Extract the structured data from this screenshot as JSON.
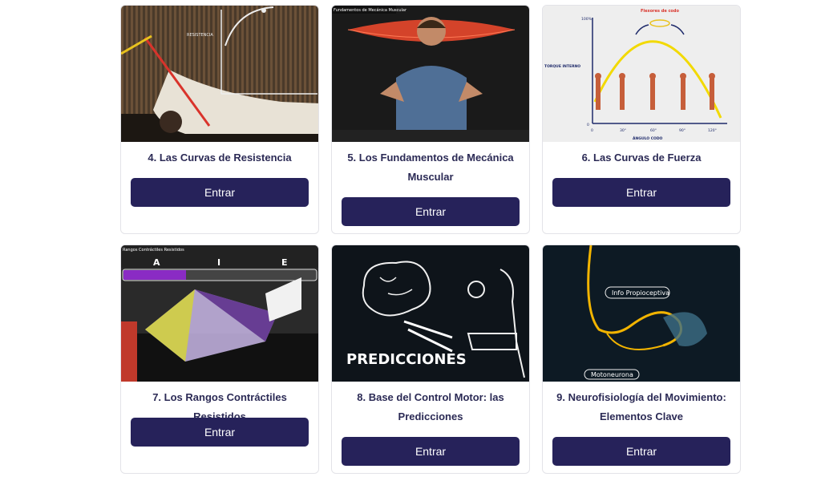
{
  "cards": [
    {
      "title": "4. Las Curvas de Resistencia",
      "button": "Entrar",
      "thumb_labels": [
        "RESISTENCIA"
      ]
    },
    {
      "title": "5. Los Fundamentos de Mecánica Muscular",
      "button": "Entrar",
      "thumb_labels": [
        "Fundamentos de Mecánica Muscular"
      ]
    },
    {
      "title": "6. Las Curvas de Fuerza",
      "button": "Entrar",
      "thumb_labels": [
        "Flexores de codo",
        "TORQUE INTERNO",
        "ÁNGULO CODO",
        "100%",
        "0",
        "30°",
        "60°",
        "90°",
        "120°"
      ]
    },
    {
      "title": "7. Los Rangos Contráctiles Resistidos",
      "button": "Entrar",
      "thumb_labels": [
        "Rangos Contráctiles Resistidos",
        "A",
        "I",
        "E"
      ]
    },
    {
      "title": "8. Base del Control Motor: las Predicciones",
      "button": "Entrar",
      "thumb_labels": [
        "PREDICCIONES"
      ]
    },
    {
      "title": "9. Neurofisiología del Movimiento: Elementos Clave",
      "button": "Entrar",
      "thumb_labels": [
        "Info Propioceptiva",
        "Motoneurona"
      ]
    }
  ],
  "colors": {
    "button_bg": "#26225a",
    "title": "#2b2a55",
    "card_border": "#e3e3e8"
  }
}
